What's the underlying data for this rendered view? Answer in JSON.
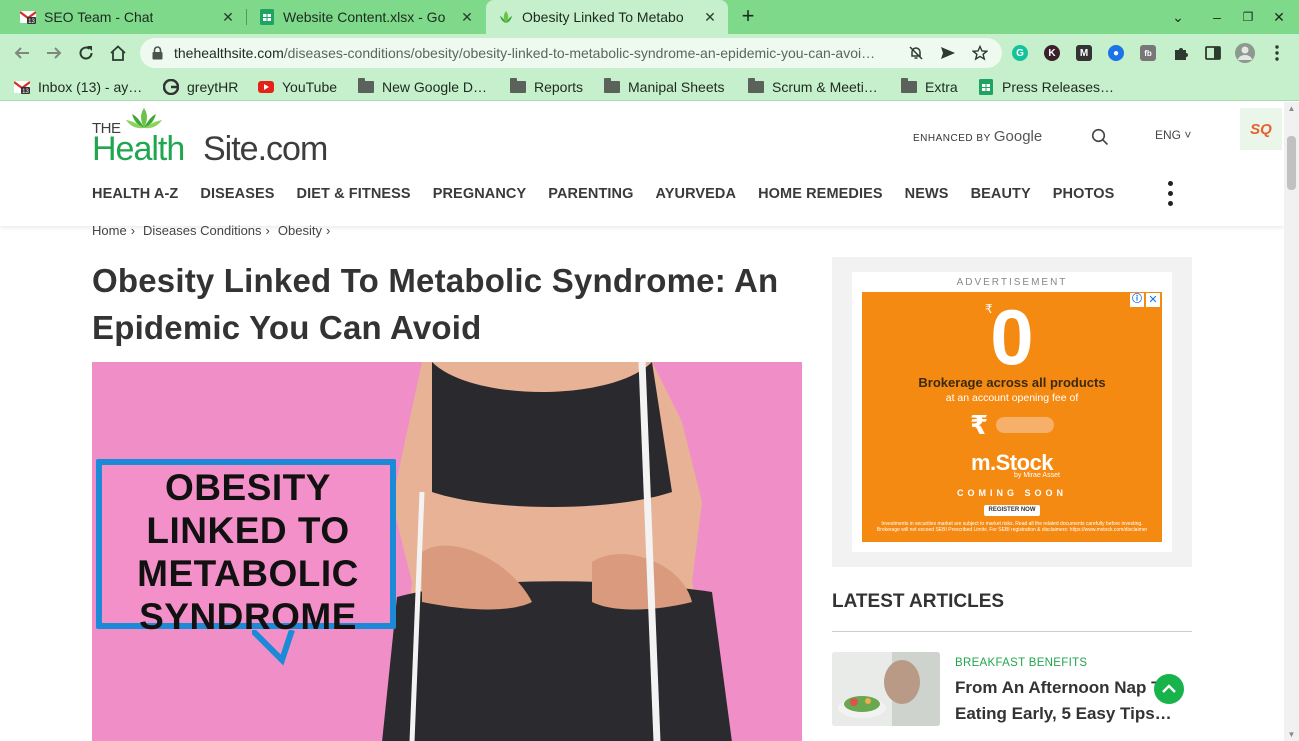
{
  "browser": {
    "tabs": [
      {
        "title": "SEO Team - Chat",
        "icon": "gmail-chat-icon",
        "badge": "13"
      },
      {
        "title": "Website Content.xlsx - Go",
        "icon": "sheets-icon"
      },
      {
        "title": "Obesity Linked To Metabo",
        "icon": "thehealthsite-favicon",
        "active": true
      }
    ],
    "new_tab": "+",
    "close_glyph": "✕",
    "window_controls": {
      "list": "⌄",
      "minimize": "–",
      "restore": "❐",
      "close": "✕"
    },
    "url_host": "thehealthsite.com",
    "url_path": "/diseases-conditions/obesity/obesity-linked-to-metabolic-syndrome-an-epidemic-you-can-avoi…",
    "extensions": [
      {
        "name": "grammarly-icon",
        "glyph": "G",
        "color": "#15c39a"
      },
      {
        "name": "k-extension-icon",
        "glyph": "K",
        "color": "#3b1f2b"
      },
      {
        "name": "m-extension-icon",
        "glyph": "M",
        "color": "#333333"
      },
      {
        "name": "screen-recorder-icon",
        "glyph": "●",
        "color": "#1a73e8"
      },
      {
        "name": "fb-extension-icon",
        "glyph": "fb",
        "color": "#777777"
      }
    ],
    "bookmarks": [
      {
        "label": "Inbox (13) - ay…",
        "icon": "gmail-icon"
      },
      {
        "label": "greytHR",
        "icon": "greythr-icon"
      },
      {
        "label": "YouTube",
        "icon": "youtube-icon"
      },
      {
        "label": "New Google D…",
        "icon": "folder-icon"
      },
      {
        "label": "Reports",
        "icon": "folder-icon"
      },
      {
        "label": "Manipal Sheets",
        "icon": "folder-icon"
      },
      {
        "label": "Scrum & Meeti…",
        "icon": "folder-icon"
      },
      {
        "label": "Extra",
        "icon": "folder-icon"
      },
      {
        "label": "Press Releases…",
        "icon": "sheets-icon"
      }
    ]
  },
  "site": {
    "logo": {
      "the": "THE",
      "health": "Health",
      "site": "Site.com"
    },
    "search_enhanced": "ENHANCED BY",
    "search_brand": "Google",
    "lang": "ENG ˅",
    "badge": "SQ",
    "nav": [
      "HEALTH A-Z",
      "DISEASES",
      "DIET & FITNESS",
      "PREGNANCY",
      "PARENTING",
      "AYURVEDA",
      "HOME REMEDIES",
      "NEWS",
      "BEAUTY",
      "PHOTOS"
    ],
    "breadcrumb": [
      "Home",
      "Diseases Conditions",
      "Obesity"
    ],
    "breadcrumb_sep": "›"
  },
  "article": {
    "headline": "Obesity Linked To Metabolic Syndrome: An Epidemic You Can Avoid",
    "hero_lines": [
      "OBESITY",
      "LINKED TO",
      "METABOLIC",
      "SYNDROME"
    ]
  },
  "sidebar": {
    "ad_label": "ADVERTISEMENT",
    "ad": {
      "currency": "₹",
      "amount": "0",
      "headline": "Brokerage across all products",
      "sub": "at an account opening fee of",
      "fee_currency": "₹",
      "brand": "m.Stock",
      "brand_sub": "by Mirae Asset",
      "coming": "COMING SOON",
      "cta": "REGISTER NOW",
      "fine": "Investments in securities market are subject to market risks. Read all the related documents carefully before investing. Brokerage will not exceed SEBI Prescribed Limits. For SEBI registration & disclaimers: https://www.mstock.com/disclaimer",
      "choices": "ⓘ",
      "close": "✕"
    },
    "latest_title": "LATEST ARTICLES",
    "articles": [
      {
        "category": "BREAKFAST BENEFITS",
        "title": "From An Afternoon Nap To Eating Early, 5 Easy Tips…"
      }
    ]
  }
}
